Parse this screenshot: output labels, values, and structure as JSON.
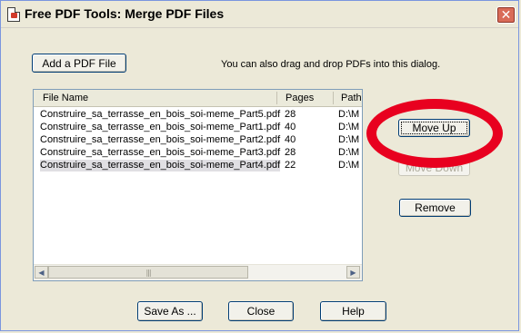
{
  "window": {
    "title": "Free PDF Tools: Merge PDF Files",
    "close_glyph": "✕"
  },
  "top": {
    "add_button": "Add a PDF File",
    "hint": "You can also drag and drop PDFs into this dialog."
  },
  "list": {
    "columns": [
      "File Name",
      "Pages",
      "Path"
    ],
    "rows": [
      {
        "name": "Construire_sa_terrasse_en_bois_soi-meme_Part5.pdf",
        "pages": "28",
        "path": "D:\\M"
      },
      {
        "name": "Construire_sa_terrasse_en_bois_soi-meme_Part1.pdf",
        "pages": "40",
        "path": "D:\\M"
      },
      {
        "name": "Construire_sa_terrasse_en_bois_soi-meme_Part2.pdf",
        "pages": "40",
        "path": "D:\\M"
      },
      {
        "name": "Construire_sa_terrasse_en_bois_soi-meme_Part3.pdf",
        "pages": "28",
        "path": "D:\\M"
      },
      {
        "name": "Construire_sa_terrasse_en_bois_soi-meme_Part4.pdf",
        "pages": "22",
        "path": "D:\\M"
      }
    ],
    "selected_row": 4
  },
  "side_buttons": {
    "move_up": "Move Up",
    "move_down": "Move Down",
    "remove": "Remove"
  },
  "bottom_buttons": {
    "save_as": "Save As ...",
    "close": "Close",
    "help": "Help"
  },
  "colors": {
    "annotation": "#e8001f",
    "window_bg": "#ece9d8"
  }
}
